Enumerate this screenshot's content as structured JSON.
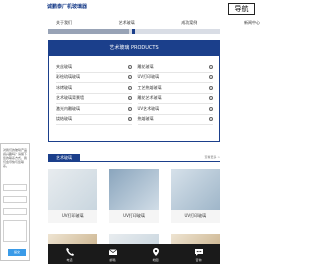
{
  "header": {
    "logo_text": "诚鹏泰厂机玻璃器",
    "nav_button": "导航"
  },
  "tabs": [
    "关于我们",
    "艺术玻璃",
    "成功案例",
    "新闻中心"
  ],
  "slider": {
    "progress_percent": 47
  },
  "products_panel": {
    "title": "艺术玻璃 PRODUCTS",
    "items": [
      [
        "夹丝玻璃",
        "雕花玻璃"
      ],
      [
        "彩绘琉璃玻璃",
        "UV打印玻璃"
      ],
      [
        "冰烤玻璃",
        "工艺热熔玻璃"
      ],
      [
        "艺术玻璃背景墙",
        "雕花艺术玻璃"
      ],
      [
        "激光内雕玻璃",
        "UV艺术玻璃"
      ],
      [
        "烧结玻璃",
        "热熔玻璃"
      ]
    ]
  },
  "section": {
    "tag": "艺术玻璃",
    "more": "查看更多 >"
  },
  "cards": [
    {
      "title": "UV打印玻璃"
    },
    {
      "title": "UV打印玻璃"
    },
    {
      "title": "UV打印玻璃"
    }
  ],
  "dialog": {
    "text": "对我们的玻璃产品感兴趣吗？请留下您的联系方式，我们会尽快与您联系。",
    "submit_label": "提交"
  },
  "bottom_bar": [
    {
      "icon": "phone-icon",
      "label": "电话"
    },
    {
      "icon": "mail-icon",
      "label": "邮箱"
    },
    {
      "icon": "location-icon",
      "label": "地图"
    },
    {
      "icon": "chat-icon",
      "label": "咨询"
    }
  ],
  "colors": {
    "primary": "#1b3f8b",
    "button_blue": "#3a9be8",
    "bottom_bar_bg": "#1a1a1a"
  }
}
